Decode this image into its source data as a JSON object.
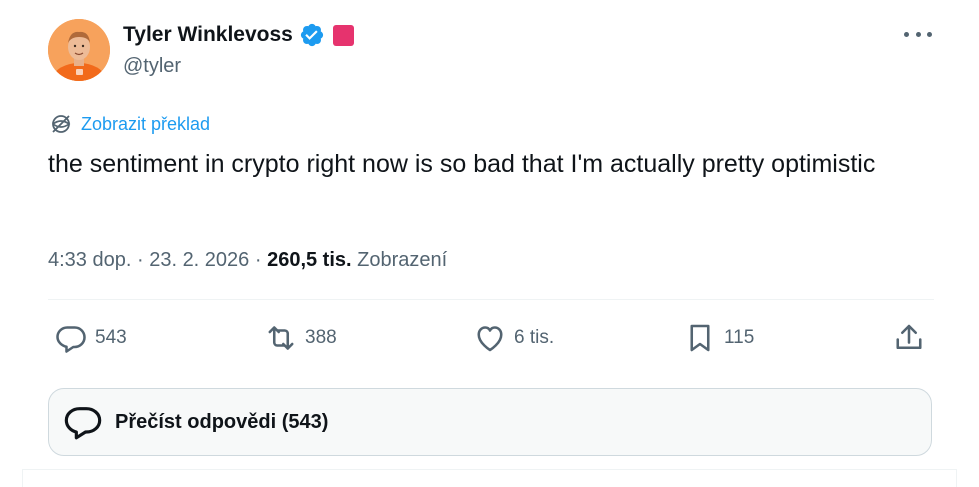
{
  "author": {
    "name": "Tyler Winklevoss",
    "handle": "@tyler",
    "verified_icon": "verified-badge-icon",
    "affiliate_badge_color": "#e6336e"
  },
  "translate": {
    "label": "Zobrazit překlad",
    "icon": "translate-globe-icon"
  },
  "tweet": {
    "text": "the sentiment in crypto right now is so bad that I'm actually pretty optimistic"
  },
  "meta": {
    "time": "4:33 dop.",
    "separator1": " · ",
    "date": "23. 2. 2026",
    "separator2": " · ",
    "views_count": "260,5 tis.",
    "views_label": "Zobrazení"
  },
  "actions": {
    "replies": "543",
    "reposts": "388",
    "likes": "6 tis.",
    "bookmarks": "115"
  },
  "read_replies": {
    "label": "Přečíst odpovědi (543)"
  },
  "colors": {
    "accent": "#1d9bf0",
    "muted": "#536471",
    "text": "#0f1419"
  }
}
